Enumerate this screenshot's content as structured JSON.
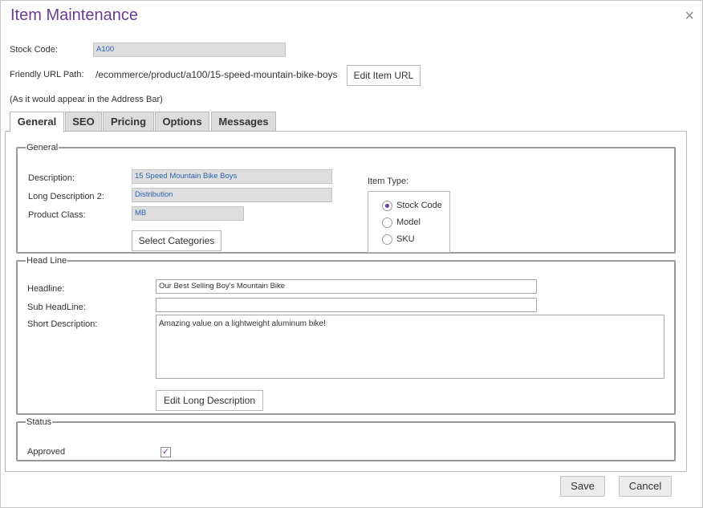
{
  "dialog": {
    "title": "Item Maintenance",
    "close_glyph": "×"
  },
  "header": {
    "stock_code_label": "Stock Code:",
    "stock_code_value": "A100",
    "url_label": "Friendly URL Path:",
    "url_value": "/ecommerce/product/a100/15-speed-mountain-bike-boys",
    "edit_url_button": "Edit Item URL",
    "address_note": "(As it would appear in the Address Bar)"
  },
  "tabs": [
    {
      "label": "General",
      "active": true
    },
    {
      "label": "SEO",
      "active": false
    },
    {
      "label": "Pricing",
      "active": false
    },
    {
      "label": "Options",
      "active": false
    },
    {
      "label": "Messages",
      "active": false
    }
  ],
  "general": {
    "legend": "General",
    "description_label": "Description:",
    "description_value": "15 Speed Mountain Bike Boys",
    "long_desc2_label": "Long Description 2:",
    "long_desc2_value": "Distribution",
    "product_class_label": "Product Class:",
    "product_class_value": "MB",
    "select_categories_button": "Select Categories",
    "item_type_label": "Item Type:",
    "item_type_options": [
      {
        "label": "Stock Code",
        "checked": true
      },
      {
        "label": "Model",
        "checked": false
      },
      {
        "label": "SKU",
        "checked": false
      }
    ]
  },
  "headline": {
    "legend": "Head Line",
    "headline_label": "Headline:",
    "headline_value": "Our Best Selling Boy's Mountain Bike",
    "subheadline_label": "Sub HeadLine:",
    "subheadline_value": "",
    "short_desc_label": "Short Description:",
    "short_desc_value": "Amazing value on a lightweight aluminum bike!",
    "edit_long_desc_button": "Edit Long Description"
  },
  "status": {
    "legend": "Status",
    "approved_label": "Approved",
    "approved_checked": true,
    "check_glyph": "✓"
  },
  "footer": {
    "save_button": "Save",
    "cancel_button": "Cancel"
  },
  "colors": {
    "accent": "#6a3d8f",
    "readonly_text": "#2a63b0",
    "readonly_bg": "#dedede"
  }
}
